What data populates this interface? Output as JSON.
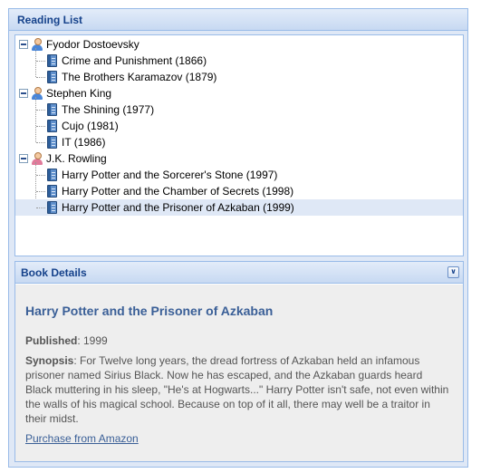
{
  "panel": {
    "title": "Reading List"
  },
  "tree": {
    "authors": [
      {
        "name": "Fyodor Dostoevsky",
        "gender": "male",
        "books": [
          "Crime and Punishment (1866)",
          "The Brothers Karamazov (1879)"
        ]
      },
      {
        "name": "Stephen King",
        "gender": "male",
        "books": [
          "The Shining (1977)",
          "Cujo (1981)",
          "IT (1986)"
        ]
      },
      {
        "name": "J.K. Rowling",
        "gender": "female",
        "books": [
          "Harry Potter and the Sorcerer's Stone (1997)",
          "Harry Potter and the Chamber of Secrets (1998)",
          "Harry Potter and the Prisoner of Azkaban (1999)"
        ]
      }
    ],
    "selected_book": "Harry Potter and the Prisoner of Azkaban (1999)"
  },
  "details": {
    "header": "Book Details",
    "title": "Harry Potter and the Prisoner of Azkaban",
    "published_label": "Published",
    "published_value": ": 1999",
    "synopsis_label": "Synopsis",
    "synopsis_text": ": For Twelve long years, the dread fortress of Azkaban held an infamous prisoner named Sirius Black. Now he has escaped, and the Azkaban guards heard Black muttering in his sleep, \"He's at Hogwarts...\" Harry Potter isn't safe, not even within the walls of his magical school. Because on top of it all, there may well be a traitor in their midst.",
    "purchase_link": "Purchase from Amazon",
    "collapse_icon": "double-chevron-down-icon"
  },
  "colors": {
    "header_text": "#15428b",
    "border": "#99bbe8",
    "selected_row": "#dfe8f6",
    "link": "#3a5f97",
    "male_icon": "#4a86d8",
    "female_icon": "#e07a9a"
  }
}
